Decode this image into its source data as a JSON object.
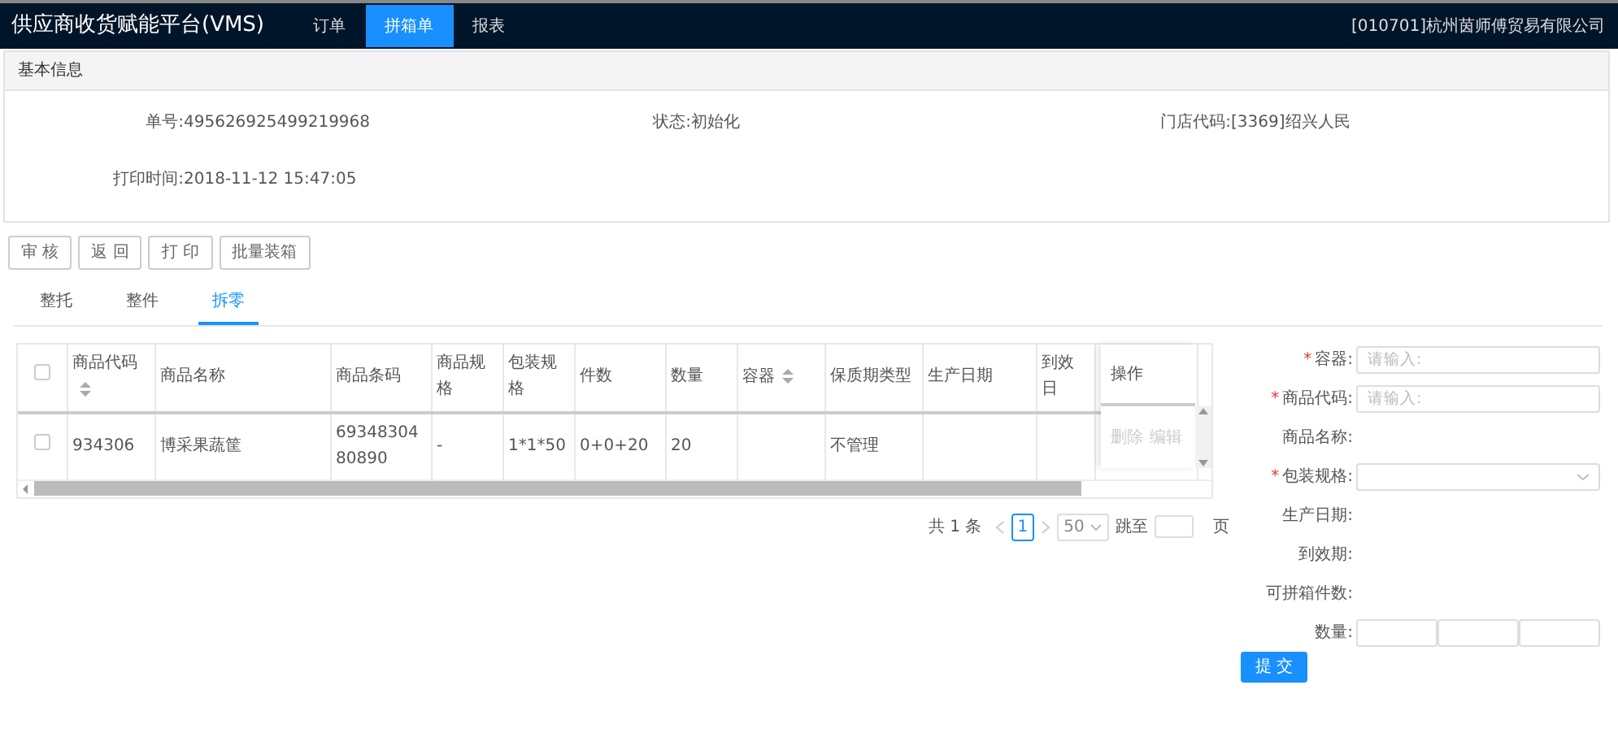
{
  "header": {
    "title": "供应商收货赋能平台(VMS)",
    "nav": [
      {
        "label": "订单",
        "selected": false
      },
      {
        "label": "拼箱单",
        "selected": true
      },
      {
        "label": "报表",
        "selected": false
      }
    ],
    "company": "[010701]杭州茵师傅贸易有限公司"
  },
  "basic_info": {
    "title": "基本信息",
    "fields": [
      {
        "label": "单号:",
        "value": "495626925499219968"
      },
      {
        "label": "状态:",
        "value": "初始化"
      },
      {
        "label": "门店代码:",
        "value": "[3369]绍兴人民"
      },
      {
        "label": "打印时间:",
        "value": "2018-11-12 15:47:05"
      }
    ]
  },
  "actions": [
    "审 核",
    "返 回",
    "打 印",
    "批量装箱"
  ],
  "tabs": [
    {
      "label": "整托",
      "selected": false
    },
    {
      "label": "整件",
      "selected": false
    },
    {
      "label": "拆零",
      "selected": true
    }
  ],
  "table": {
    "columns": [
      {
        "label": "商品代码",
        "sortable": true
      },
      {
        "label": "商品名称",
        "sortable": false
      },
      {
        "label": "商品条码",
        "sortable": false
      },
      {
        "label": "商品规格",
        "sortable": false
      },
      {
        "label": "包装规格",
        "sortable": false
      },
      {
        "label": "件数",
        "sortable": false
      },
      {
        "label": "数量",
        "sortable": false
      },
      {
        "label": "容器",
        "sortable": true
      },
      {
        "label": "保质期类型",
        "sortable": false
      },
      {
        "label": "生产日期",
        "sortable": false
      },
      {
        "label": "到效日",
        "sortable": false
      }
    ],
    "action_column": "操作",
    "all_checked": false,
    "rows": [
      {
        "checked": false,
        "cells": [
          "934306",
          "博采果蔬筐",
          "6934830480890",
          "-",
          "1*1*50",
          "0+0+20",
          "20",
          "",
          "不管理",
          "",
          ""
        ],
        "actions": [
          "删除",
          "编辑"
        ]
      }
    ]
  },
  "pagination": {
    "total": "共 1 条",
    "pages": [
      {
        "label": "1",
        "selected": true
      }
    ],
    "page_size": "50",
    "jump_label": "跳至",
    "page_suffix": "页"
  },
  "form": {
    "fields": [
      {
        "kind": "input",
        "label": "容器:",
        "required_mark": "*",
        "placeholder": "请输入:"
      },
      {
        "kind": "input",
        "label": "商品代码:",
        "required_mark": "*",
        "placeholder": "请输入:"
      },
      {
        "kind": "text",
        "label": "商品名称:"
      },
      {
        "kind": "select",
        "label": "包装规格:",
        "required_mark": "*"
      },
      {
        "kind": "text",
        "label": "生产日期:"
      },
      {
        "kind": "text",
        "label": "到效期:"
      },
      {
        "kind": "text",
        "label": "可拼箱件数:"
      },
      {
        "kind": "triple",
        "label": "数量:"
      }
    ],
    "submit": "提 交"
  }
}
